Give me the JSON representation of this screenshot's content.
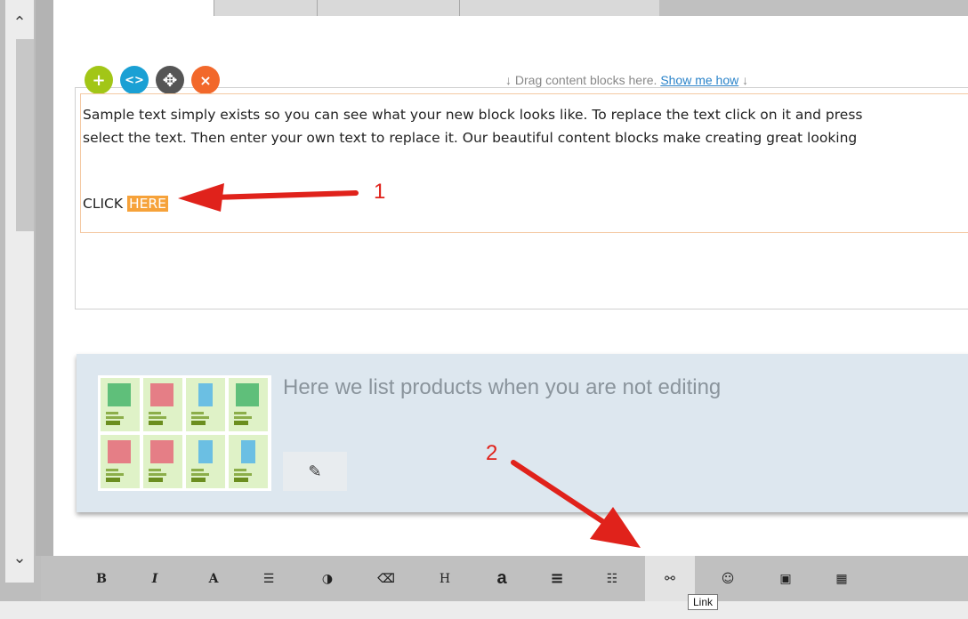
{
  "editor": {
    "drag_hint_text": "Drag content blocks here.",
    "show_me_how": "Show me how",
    "paragraph_1": "Sample text simply exists so you can see what your new block looks like. To replace the text click on it and press",
    "paragraph_2": "select the text. Then enter your own text to replace it. Our beautiful content blocks make creating great looking",
    "click_label": "CLICK",
    "here_label": "HERE"
  },
  "block_controls": {
    "add": "+",
    "code": "<>",
    "move": "✥",
    "delete": "×"
  },
  "products": {
    "placeholder_text": "Here we list products when you are not editing",
    "edit_icon": "✎"
  },
  "annotations": {
    "step1": "1",
    "step2": "2"
  },
  "toolbar": {
    "bold": "B",
    "italic": "I",
    "font": "A",
    "paragraph_settings": "☰",
    "contrast": "◑",
    "eraser": "⌫",
    "heading": "H",
    "text_style": "a",
    "align": "≡",
    "list": "☷",
    "link": "⚯",
    "emoji": "☺",
    "image": "▣",
    "table": "▦"
  },
  "tooltip": {
    "link": "Link"
  },
  "colors": {
    "arrow_red": "#e0221b",
    "highlight_orange": "#f6a23a"
  }
}
